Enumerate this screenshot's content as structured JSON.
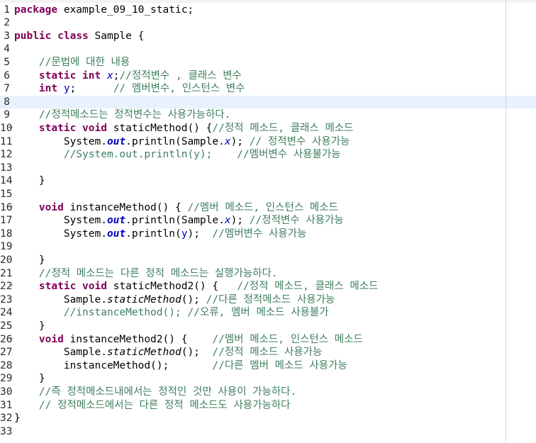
{
  "editor": {
    "lines": [
      {
        "num": "1",
        "fold": "",
        "tokens": [
          {
            "t": "package",
            "c": "kw"
          },
          {
            "t": " example_09_10_static;",
            "c": "pl"
          }
        ]
      },
      {
        "num": "2",
        "fold": "",
        "tokens": []
      },
      {
        "num": "3",
        "fold": "",
        "tokens": [
          {
            "t": "public",
            "c": "kw"
          },
          {
            "t": " ",
            "c": "pl"
          },
          {
            "t": "class",
            "c": "kw"
          },
          {
            "t": " Sample {",
            "c": "pl"
          }
        ]
      },
      {
        "num": "4",
        "fold": "",
        "tokens": []
      },
      {
        "num": "5",
        "fold": "",
        "tokens": [
          {
            "t": "    ",
            "c": "pl"
          },
          {
            "t": "//문법에 대한 내용",
            "c": "cm"
          }
        ]
      },
      {
        "num": "6",
        "fold": "",
        "tokens": [
          {
            "t": "    ",
            "c": "pl"
          },
          {
            "t": "static",
            "c": "kw"
          },
          {
            "t": " ",
            "c": "pl"
          },
          {
            "t": "int",
            "c": "kw"
          },
          {
            "t": " ",
            "c": "pl"
          },
          {
            "t": "x",
            "c": "fs"
          },
          {
            "t": ";",
            "c": "pl"
          },
          {
            "t": "//정적변수 , 클래스 변수",
            "c": "cm"
          }
        ]
      },
      {
        "num": "7",
        "fold": "",
        "tokens": [
          {
            "t": "    ",
            "c": "pl"
          },
          {
            "t": "int",
            "c": "kw"
          },
          {
            "t": " ",
            "c": "pl"
          },
          {
            "t": "y",
            "c": "fi"
          },
          {
            "t": ";      ",
            "c": "pl"
          },
          {
            "t": "// 멤버변수, 인스턴스 변수",
            "c": "cm"
          }
        ]
      },
      {
        "num": "8",
        "fold": "",
        "current": true,
        "tokens": []
      },
      {
        "num": "9",
        "fold": "",
        "tokens": [
          {
            "t": "    ",
            "c": "pl"
          },
          {
            "t": "//정적메소드는 정적변수는 사용가능하다.",
            "c": "cm"
          }
        ]
      },
      {
        "num": "10",
        "fold": "⊖",
        "tokens": [
          {
            "t": "    ",
            "c": "pl"
          },
          {
            "t": "static",
            "c": "kw"
          },
          {
            "t": " ",
            "c": "pl"
          },
          {
            "t": "void",
            "c": "kw"
          },
          {
            "t": " staticMethod() {",
            "c": "pl"
          },
          {
            "t": "//정적 메소드, 클래스 메소드",
            "c": "cm"
          }
        ]
      },
      {
        "num": "11",
        "fold": "",
        "tokens": [
          {
            "t": "        System.",
            "c": "pl"
          },
          {
            "t": "out",
            "c": "fsb"
          },
          {
            "t": ".println(Sample.",
            "c": "pl"
          },
          {
            "t": "x",
            "c": "fs"
          },
          {
            "t": "); ",
            "c": "pl"
          },
          {
            "t": "// 정적변수 사용가능",
            "c": "cm"
          }
        ]
      },
      {
        "num": "12",
        "fold": "",
        "tokens": [
          {
            "t": "        ",
            "c": "pl"
          },
          {
            "t": "//System.out.println(y);    //멤버변수 사용불가능",
            "c": "cm"
          }
        ]
      },
      {
        "num": "13",
        "fold": "",
        "tokens": []
      },
      {
        "num": "14",
        "fold": "",
        "tokens": [
          {
            "t": "    }",
            "c": "pl"
          }
        ]
      },
      {
        "num": "15",
        "fold": "",
        "tokens": []
      },
      {
        "num": "16",
        "fold": "⊖",
        "tokens": [
          {
            "t": "    ",
            "c": "pl"
          },
          {
            "t": "void",
            "c": "kw"
          },
          {
            "t": " instanceMethod() { ",
            "c": "pl"
          },
          {
            "t": "//멤버 메소드, 인스턴스 메소드",
            "c": "cm"
          }
        ]
      },
      {
        "num": "17",
        "fold": "",
        "tokens": [
          {
            "t": "        System.",
            "c": "pl"
          },
          {
            "t": "out",
            "c": "fsb"
          },
          {
            "t": ".println(Sample.",
            "c": "pl"
          },
          {
            "t": "x",
            "c": "fs"
          },
          {
            "t": "); ",
            "c": "pl"
          },
          {
            "t": "//정적변수 사용가능",
            "c": "cm"
          }
        ]
      },
      {
        "num": "18",
        "fold": "",
        "tokens": [
          {
            "t": "        System.",
            "c": "pl"
          },
          {
            "t": "out",
            "c": "fsb"
          },
          {
            "t": ".println(",
            "c": "pl"
          },
          {
            "t": "y",
            "c": "fi"
          },
          {
            "t": ");  ",
            "c": "pl"
          },
          {
            "t": "//멤버변수 사용가능",
            "c": "cm"
          }
        ]
      },
      {
        "num": "19",
        "fold": "",
        "tokens": []
      },
      {
        "num": "20",
        "fold": "",
        "tokens": [
          {
            "t": "    }",
            "c": "pl"
          }
        ]
      },
      {
        "num": "21",
        "fold": "",
        "tokens": [
          {
            "t": "    ",
            "c": "pl"
          },
          {
            "t": "//정적 메소드는 다른 정적 메소드는 실행가능하다.",
            "c": "cm"
          }
        ]
      },
      {
        "num": "22",
        "fold": "⊖",
        "tokens": [
          {
            "t": "    ",
            "c": "pl"
          },
          {
            "t": "static",
            "c": "kw"
          },
          {
            "t": " ",
            "c": "pl"
          },
          {
            "t": "void",
            "c": "kw"
          },
          {
            "t": " staticMethod2() {   ",
            "c": "pl"
          },
          {
            "t": "//정적 메소드, 클래스 메소드",
            "c": "cm"
          }
        ]
      },
      {
        "num": "23",
        "fold": "",
        "tokens": [
          {
            "t": "        Sample.",
            "c": "pl"
          },
          {
            "t": "staticMethod",
            "c": "sm"
          },
          {
            "t": "(); ",
            "c": "pl"
          },
          {
            "t": "//다른 정적메소드 사용가능",
            "c": "cm"
          }
        ]
      },
      {
        "num": "24",
        "fold": "",
        "tokens": [
          {
            "t": "        ",
            "c": "pl"
          },
          {
            "t": "//instanceMethod(); //오류, 멤버 메소드 사용불가",
            "c": "cm"
          }
        ]
      },
      {
        "num": "25",
        "fold": "",
        "tokens": [
          {
            "t": "    }",
            "c": "pl"
          }
        ]
      },
      {
        "num": "26",
        "fold": "⊖",
        "tokens": [
          {
            "t": "    ",
            "c": "pl"
          },
          {
            "t": "void",
            "c": "kw"
          },
          {
            "t": " instanceMethod2() {    ",
            "c": "pl"
          },
          {
            "t": "//멤버 메소드, 인스턴스 메소드",
            "c": "cm"
          }
        ]
      },
      {
        "num": "27",
        "fold": "",
        "tokens": [
          {
            "t": "        Sample.",
            "c": "pl"
          },
          {
            "t": "staticMethod",
            "c": "sm"
          },
          {
            "t": "();  ",
            "c": "pl"
          },
          {
            "t": "//정적 메소드 사용가능",
            "c": "cm"
          }
        ]
      },
      {
        "num": "28",
        "fold": "",
        "tokens": [
          {
            "t": "        instanceMethod();       ",
            "c": "pl"
          },
          {
            "t": "//다른 멤버 메소드 사용가능",
            "c": "cm"
          }
        ]
      },
      {
        "num": "29",
        "fold": "",
        "tokens": [
          {
            "t": "    }",
            "c": "pl"
          }
        ]
      },
      {
        "num": "30",
        "fold": "",
        "tokens": [
          {
            "t": "    ",
            "c": "pl"
          },
          {
            "t": "//즉 정적메소드내에서는 정적인 것만 사용이 가능하다.",
            "c": "cm"
          }
        ]
      },
      {
        "num": "31",
        "fold": "",
        "tokens": [
          {
            "t": "    ",
            "c": "pl"
          },
          {
            "t": "// 정적메소드에서는 다른 정적 메소드도 사용가능하다",
            "c": "cm"
          }
        ]
      },
      {
        "num": "32",
        "fold": "",
        "tokens": [
          {
            "t": "}",
            "c": "pl"
          }
        ]
      },
      {
        "num": "33",
        "fold": "",
        "tokens": []
      }
    ]
  },
  "colors": {
    "keyword": "#7f0055",
    "comment": "#3f7f5f",
    "field": "#0000c0",
    "current_line": "#e8f2fe"
  }
}
